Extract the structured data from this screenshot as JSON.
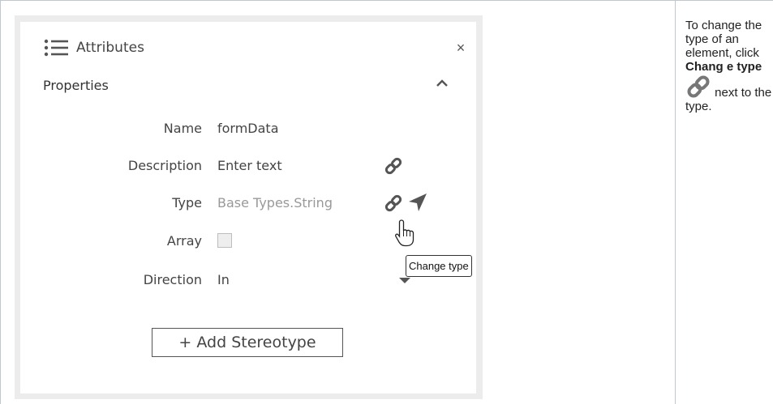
{
  "panel": {
    "title": "Attributes",
    "close_label": "×",
    "section_title": "Properties"
  },
  "fields": {
    "name_label": "Name",
    "name_value": "formData",
    "description_label": "Description",
    "description_placeholder": "Enter text",
    "type_label": "Type",
    "type_value": "Base Types.String",
    "array_label": "Array",
    "direction_label": "Direction",
    "direction_value": "In"
  },
  "tooltip": {
    "text": "Change type"
  },
  "buttons": {
    "add_stereotype": "+ Add Stereotype"
  },
  "help": {
    "line1": "To change the type of an element, click",
    "bold": "Chang e type",
    "line2": "next to the type."
  },
  "icons": {
    "list": "list-icon",
    "close": "close-icon",
    "collapse": "chevron-up-icon",
    "link": "link-icon",
    "navigate": "navigate-arrow-icon",
    "dropdown": "caret-down-icon",
    "cursor": "hand-cursor-icon"
  },
  "colors": {
    "icon_gray": "#555555",
    "panel_border": "#ececec",
    "checkbox_fill": "#eeeeee"
  }
}
